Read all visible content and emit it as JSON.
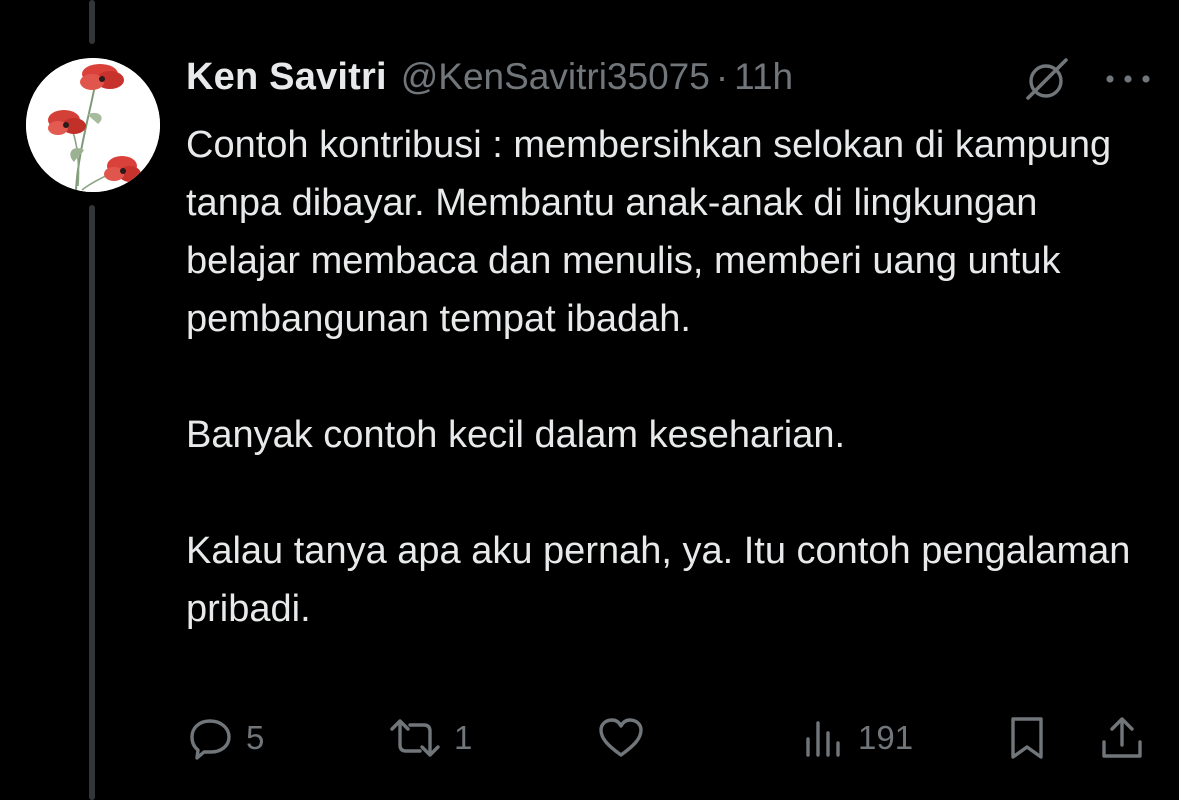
{
  "tweet": {
    "author": {
      "display_name": "Ken Savitri",
      "handle": "@KenSavitri35075",
      "avatar_icon": "red-poppy-flowers-avatar"
    },
    "separator": "·",
    "timestamp": "11h",
    "paragraphs": [
      "Contoh kontribusi : membersihkan selokan di kampung tanpa dibayar. Membantu anak-anak di lingkungan belajar membaca dan menulis, memberi uang untuk pembangunan tempat ibadah.",
      "Banyak contoh kecil dalam keseharian.",
      "Kalau tanya apa aku pernah, ya. Itu contoh pengalaman pribadi."
    ],
    "top_right_icons": [
      "grok-icon",
      "more-options-icon"
    ],
    "actions": {
      "reply": {
        "icon": "reply-icon",
        "count": "5"
      },
      "retweet": {
        "icon": "retweet-icon",
        "count": "1"
      },
      "like": {
        "icon": "heart-icon",
        "count": ""
      },
      "views": {
        "icon": "views-icon",
        "count": "191"
      },
      "bookmark": {
        "icon": "bookmark-icon"
      },
      "share": {
        "icon": "share-icon"
      }
    }
  },
  "colors": {
    "background": "#000000",
    "primary_text": "#e7e9ea",
    "secondary_text": "#71767b",
    "thread_line": "#333639",
    "avatar_flower": "#d9413a"
  }
}
